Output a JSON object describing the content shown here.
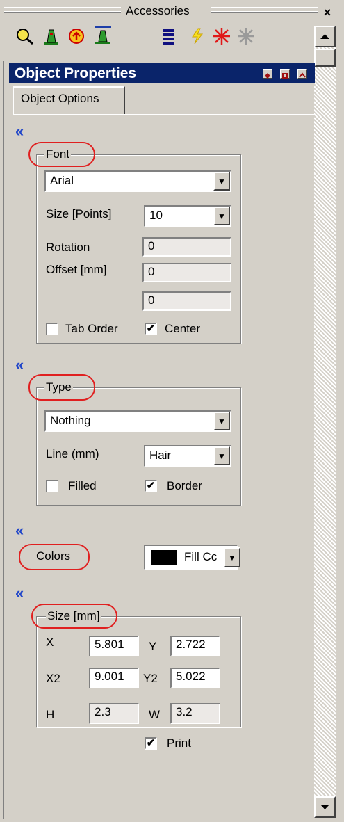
{
  "toolbar": {
    "title": "Accessories",
    "close": "×"
  },
  "panel": {
    "title": "Object Properties",
    "tab": "Object Options",
    "collapse_glyph": "«"
  },
  "font": {
    "legend": "Font",
    "family": "Arial",
    "size_label": "Size [Points]",
    "size": "10",
    "rotation_label": "Rotation",
    "rotation": "0",
    "offset_label": "Offset [mm]",
    "offset_x": "0",
    "offset_y": "0",
    "tab_order_label": "Tab Order",
    "tab_order_checked": false,
    "center_label": "Center",
    "center_checked": true
  },
  "type": {
    "legend": "Type",
    "value": "Nothing",
    "line_label": "Line (mm)",
    "line": "Hair",
    "filled_label": "Filled",
    "filled_checked": false,
    "border_label": "Border",
    "border_checked": true
  },
  "colors": {
    "label": "Colors",
    "fill_label": "Fill Cc",
    "fill_color": "#000000"
  },
  "size": {
    "legend": "Size [mm]",
    "x_label": "X",
    "x": "5.801",
    "y_label": "Y",
    "y": "2.722",
    "x2_label": "X2",
    "x2": "9.001",
    "y2_label": "Y2",
    "y2": "5.022",
    "h_label": "H",
    "h": "2.3",
    "w_label": "W",
    "w": "3.2"
  },
  "print": {
    "label": "Print",
    "checked": true
  },
  "check_glyph": "✔",
  "arrow_down": "▼"
}
